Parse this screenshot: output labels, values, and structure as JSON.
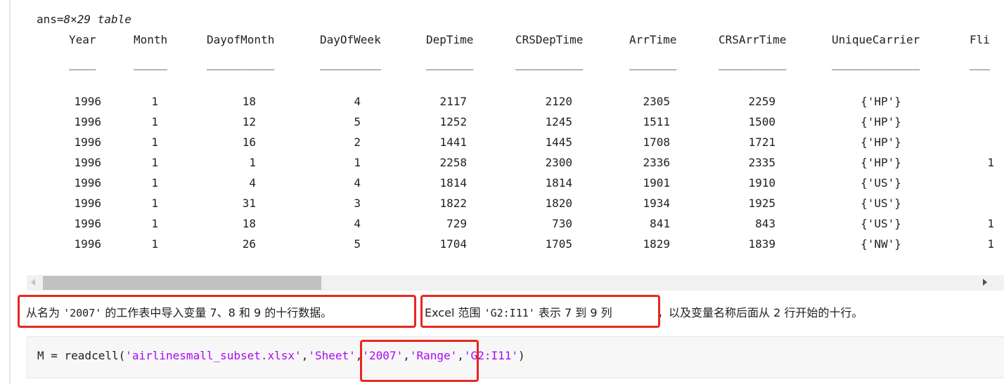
{
  "output": {
    "ans_prefix": "ans=",
    "ans_dims": "8×29 table",
    "columns": [
      {
        "header": "Year",
        "underline": "____"
      },
      {
        "header": "Month",
        "underline": "_____"
      },
      {
        "header": "DayofMonth",
        "underline": "__________"
      },
      {
        "header": "DayOfWeek",
        "underline": "_________"
      },
      {
        "header": "DepTime",
        "underline": "_______"
      },
      {
        "header": "CRSDepTime",
        "underline": "__________"
      },
      {
        "header": "ArrTime",
        "underline": "_______"
      },
      {
        "header": "CRSArrTime",
        "underline": "__________"
      },
      {
        "header": "UniqueCarrier",
        "underline": "_____________"
      },
      {
        "header": "Fli",
        "underline": "___"
      }
    ],
    "rows": [
      [
        "1996",
        "1",
        "18",
        "4",
        "2117",
        "2120",
        "2305",
        "2259",
        "{'HP'}",
        ""
      ],
      [
        "1996",
        "1",
        "12",
        "5",
        "1252",
        "1245",
        "1511",
        "1500",
        "{'HP'}",
        ""
      ],
      [
        "1996",
        "1",
        "16",
        "2",
        "1441",
        "1445",
        "1708",
        "1721",
        "{'HP'}",
        ""
      ],
      [
        "1996",
        "1",
        "1",
        "1",
        "2258",
        "2300",
        "2336",
        "2335",
        "{'HP'}",
        "1"
      ],
      [
        "1996",
        "1",
        "4",
        "4",
        "1814",
        "1814",
        "1901",
        "1910",
        "{'US'}",
        ""
      ],
      [
        "1996",
        "1",
        "31",
        "3",
        "1822",
        "1820",
        "1934",
        "1925",
        "{'US'}",
        ""
      ],
      [
        "1996",
        "1",
        "18",
        "4",
        "729",
        "730",
        "841",
        "843",
        "{'US'}",
        "1"
      ],
      [
        "1996",
        "1",
        "26",
        "5",
        "1704",
        "1705",
        "1829",
        "1839",
        "{'NW'}",
        "1"
      ]
    ]
  },
  "description": {
    "part1": "从名为 ",
    "sheet_code": "'2007'",
    "part2": " 的工作表中导入变量 7、8 和 9 的十行数据。",
    "part3": "Excel 范围 ",
    "range_code": "'G2:I11'",
    "part4": " 表示 7 到 9 列",
    "part5": "，以及变量名称后面从 2 行开始的十行。"
  },
  "code": {
    "prefix": "M = readcell(",
    "arg1": "'airlinesmall_subset.xlsx'",
    "sep1": ",",
    "arg2": "'Sheet'",
    "sep2": ",",
    "arg3": "'2007'",
    "sep3": ",",
    "arg4": "'Range'",
    "sep4": ",",
    "arg5": "'G2:I11'",
    "suffix": ")"
  },
  "colors": {
    "string": "#a709f5",
    "highlight": "#e8261f"
  }
}
